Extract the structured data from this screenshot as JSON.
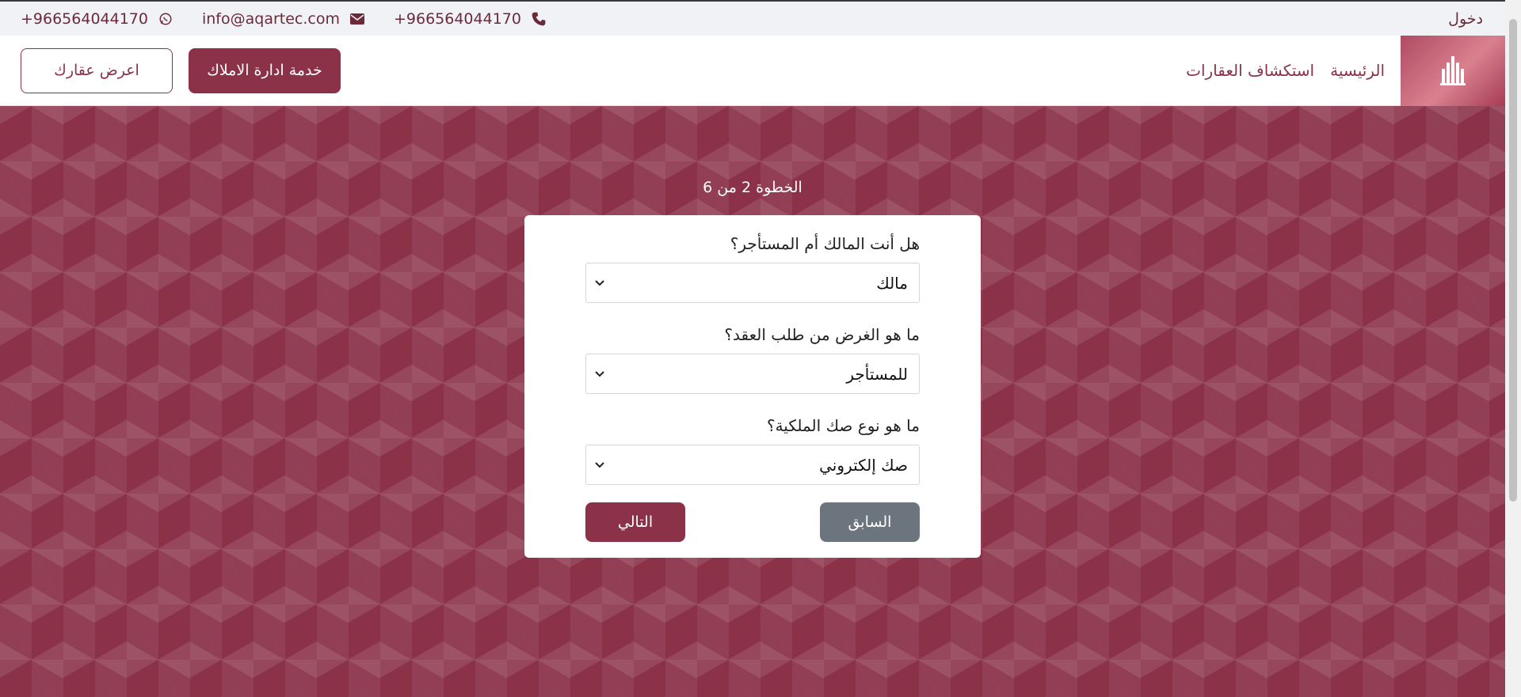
{
  "topbar": {
    "whatsapp": "+966564044170",
    "email": "info@aqartec.com",
    "phone": "+966564044170",
    "login": "دخول"
  },
  "nav": {
    "offer_property": "اعرض عقارك",
    "property_management": "خدمة ادارة الاملاك",
    "explore": "استكشاف العقارات",
    "home": "الرئيسية"
  },
  "wizard": {
    "step_label": "الخطوة 2 من 6",
    "questions": [
      {
        "label": "هل أنت المالك أم المستأجر؟",
        "value": "مالك"
      },
      {
        "label": "ما هو الغرض من طلب العقد؟",
        "value": "للمستأجر"
      },
      {
        "label": "ما هو نوع صك الملكية؟",
        "value": "صك إلكتروني"
      }
    ],
    "prev": "السابق",
    "next": "التالي"
  },
  "colors": {
    "brand": "#8b3249",
    "secondary": "#6c757d"
  }
}
